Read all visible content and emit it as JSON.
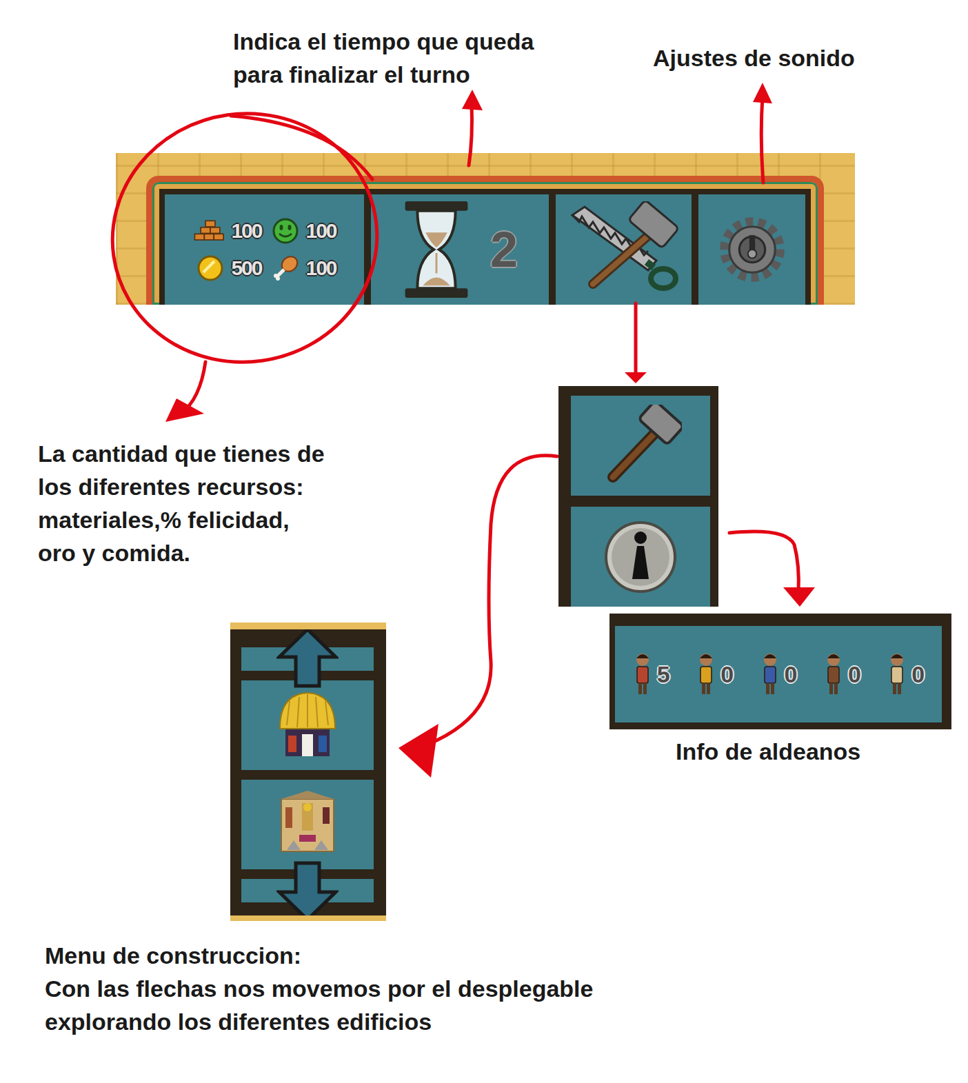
{
  "annotations": {
    "turn_timer": [
      "Indica el tiempo que queda",
      "para finalizar el turno"
    ],
    "sound": [
      "Ajustes de sonido"
    ],
    "resources": [
      "La cantidad que tienes de",
      "los diferentes recursos:",
      "materiales,% felicidad,",
      "oro y comida."
    ],
    "villagers": [
      "Info de aldeanos"
    ],
    "build_menu": [
      "Menu de construccion:",
      "Con las flechas nos movemos por el desplegable",
      "explorando los diferentes edificios"
    ]
  },
  "top_bar": {
    "resources": [
      {
        "kind": "materials",
        "value": "100"
      },
      {
        "kind": "happiness",
        "value": "100"
      },
      {
        "kind": "gold",
        "value": "500"
      },
      {
        "kind": "food",
        "value": "100"
      }
    ],
    "turn_time": "2"
  },
  "villagers": [
    {
      "count": "5",
      "color": "#b5452f"
    },
    {
      "count": "0",
      "color": "#d9a020"
    },
    {
      "count": "0",
      "color": "#3a5aa8"
    },
    {
      "count": "0",
      "color": "#7a4a2a"
    },
    {
      "count": "0",
      "color": "#d8c090"
    }
  ],
  "buildings": [
    {
      "kind": "hut"
    },
    {
      "kind": "house"
    }
  ]
}
